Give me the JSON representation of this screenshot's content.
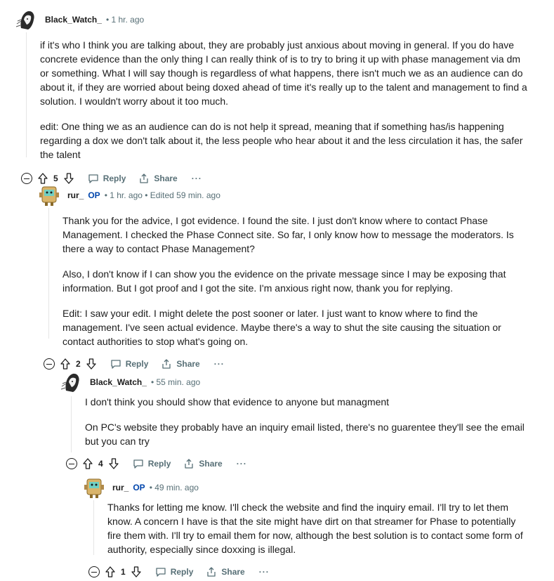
{
  "comments": [
    {
      "username": "Black_Watch_",
      "op_badge": "",
      "meta": "• 1 hr. ago",
      "paragraphs": [
        "if it's who I think you are talking about, they are probably just anxious about moving in general. If you do have concrete evidence than the only thing I can really think of is to try to bring it up with phase management via dm or something. What I will say though is regardless of what happens, there isn't much we as an audience can do about it, if they are worried about being doxed ahead of time it's really up to the talent and management to find a solution. I wouldn't worry about it too much.",
        "edit: One thing we as an audience can do is not help it spread, meaning that if something has/is happening regarding a dox we don't talk about it, the less people who hear about it and the less circulation it has, the safer the talent"
      ],
      "score": "5",
      "reply_label": "Reply",
      "share_label": "Share",
      "more_label": "···"
    },
    {
      "username": "rur_",
      "op_badge": "OP",
      "meta": "• 1 hr. ago • Edited 59 min. ago",
      "paragraphs": [
        "Thank you for the advice, I got evidence. I found the site. I just don't know where to contact Phase Management. I checked the Phase Connect site. So far, I only know how to message the moderators. Is there a way to contact Phase Management?",
        "Also, I don't know if I can show you the evidence on the private message since I may be exposing that information. But I got proof and I got the site. I'm anxious right now, thank you for replying.",
        "Edit: I saw your edit. I might delete the post sooner or later. I just want to know where to find the management. I've seen actual evidence. Maybe there's a way to shut the site causing the situation or contact authorities to stop what's going on."
      ],
      "score": "2",
      "reply_label": "Reply",
      "share_label": "Share",
      "more_label": "···"
    },
    {
      "username": "Black_Watch_",
      "op_badge": "",
      "meta": "• 55 min. ago",
      "paragraphs": [
        "I don't think you should show that evidence to anyone but managment",
        "On PC's website they probably have an inquiry email listed, there's no guarentee they'll see the email but you can try"
      ],
      "score": "4",
      "reply_label": "Reply",
      "share_label": "Share",
      "more_label": "···"
    },
    {
      "username": "rur_",
      "op_badge": "OP",
      "meta": "• 49 min. ago",
      "paragraphs": [
        "Thanks for letting me know. I'll check the website and find the inquiry email. I'll try to let them know. A concern I have is that the site might have dirt on that streamer for Phase to potentially fire them with. I'll try to email them for now, although the best solution is to contact some form of authority, especially since doxxing is illegal."
      ],
      "score": "1",
      "reply_label": "Reply",
      "share_label": "Share",
      "more_label": "···"
    }
  ]
}
